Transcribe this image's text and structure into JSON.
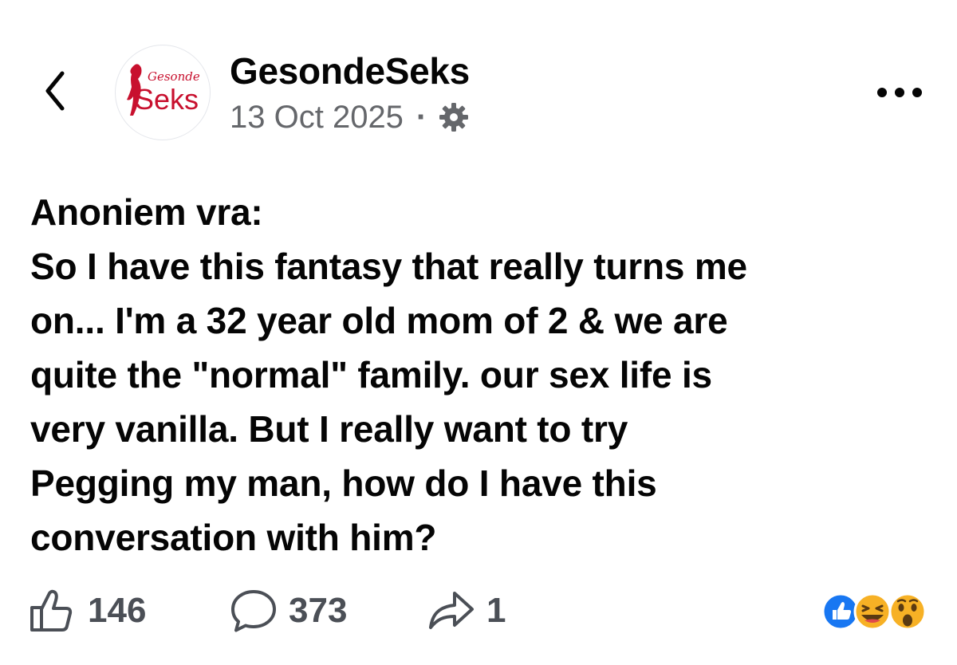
{
  "header": {
    "page_name": "GesondeSeks",
    "date": "13 Oct 2025",
    "separator": "·",
    "avatar_logo": {
      "script_text": "Gesonde",
      "main_text": "Seks",
      "brand_color": "#c8102e"
    }
  },
  "post": {
    "lines": [
      "Anoniem vra:",
      "So I have this fantasy that really turns me",
      "on... I'm a 32 year old mom of 2 & we are",
      "quite the \"normal\" family. our sex life is",
      "very vanilla. But I really want to try",
      "Pegging my man, how do I have this",
      "conversation with him?"
    ]
  },
  "actions": {
    "likes": "146",
    "comments": "373",
    "shares": "1"
  },
  "reactions": [
    "like-icon",
    "laugh-icon",
    "wow-icon"
  ],
  "colors": {
    "text": "#050505",
    "secondary": "#65676b",
    "action": "#4b4f56",
    "like_blue": "#1877f2",
    "emoji_yellow": "#f7b125"
  }
}
